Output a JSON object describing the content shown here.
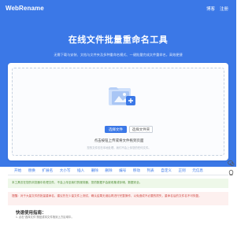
{
  "header": {
    "brand": "WebRename",
    "nav": [
      "博客",
      "注册"
    ]
  },
  "hero": {
    "title": "在线文件批量重命名工具",
    "subtitle": "无需下载与安装、文档与文件夹及多种重命名模式、一键批量完成文件重命名，高效便捷"
  },
  "upload": {
    "select_files": "选择文件",
    "select_folder": "选择文件夹",
    "drop_hint": "点击按钮上传或将文件拖到页面",
    "drop_note": "您的文件仅在本地处理，我们不会上传您的任何文件。"
  },
  "toolbar": {
    "tabs": [
      "开始",
      "替换",
      "扩展名",
      "大小写",
      "插入",
      "删除",
      "删除",
      "编号",
      "移动",
      "列表",
      "自定义",
      "正则",
      "元信息"
    ]
  },
  "notices": {
    "green": "本工具仅在您的浏览器中处理文件，不会上传至我们的服务器，您的数据不会被收集或存储，数据安全。",
    "red": "提醒：对于大量文件的批量重命名，建议先在少量文件上测试，确认结果无误后再进行完整操作，以免造成不必要的损失，重命名后的文件名不可恢复。"
  },
  "guide": {
    "title": "快速使用指南：",
    "text": "1. 点击“选择文件”按钮或将文件拖到上方区域中。"
  },
  "colors": {
    "accent": "#3b78e7",
    "success": "#4e8b34",
    "danger": "#d14a45"
  },
  "icons": {
    "upload": "folder-image-icon",
    "side": [
      "wechat-icon",
      "qq-icon",
      "gear-icon",
      "back-to-top-icon"
    ]
  }
}
